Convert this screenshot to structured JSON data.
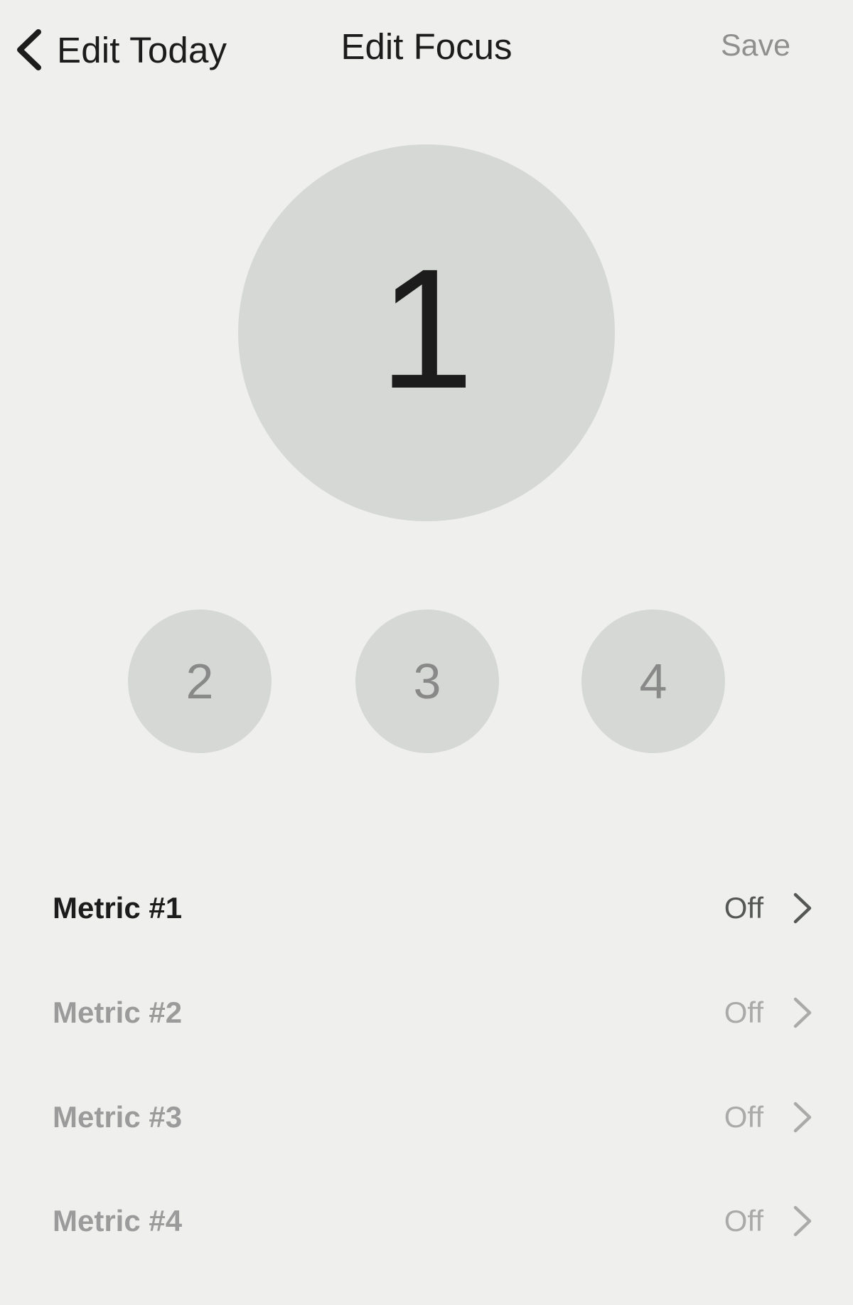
{
  "header": {
    "back_label": "Edit Today",
    "title": "Edit Focus",
    "save_label": "Save"
  },
  "focus": {
    "selected": "1",
    "options": [
      "2",
      "3",
      "4"
    ]
  },
  "metrics": [
    {
      "label": "Metric #1",
      "value": "Off",
      "active": true
    },
    {
      "label": "Metric #2",
      "value": "Off",
      "active": false
    },
    {
      "label": "Metric #3",
      "value": "Off",
      "active": false
    },
    {
      "label": "Metric #4",
      "value": "Off",
      "active": false
    }
  ],
  "colors": {
    "background": "#eff0ee",
    "circle": "#d6d8d5",
    "text_primary": "#1b1c1b",
    "text_disabled": "#9a9b9a"
  }
}
